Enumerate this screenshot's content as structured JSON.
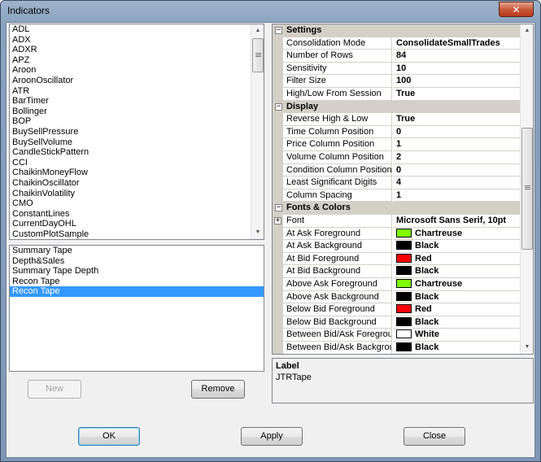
{
  "window": {
    "title": "Indicators",
    "close_glyph": "✕"
  },
  "indicators": [
    "ADL",
    "ADX",
    "ADXR",
    "APZ",
    "Aroon",
    "AroonOscillator",
    "ATR",
    "BarTimer",
    "Bollinger",
    "BOP",
    "BuySellPressure",
    "BuySellVolume",
    "CandleStickPattern",
    "CCI",
    "ChaikinMoneyFlow",
    "ChaikinOscillator",
    "ChaikinVolatility",
    "CMO",
    "ConstantLines",
    "CurrentDayOHL",
    "CustomPlotSample"
  ],
  "configured": {
    "items": [
      "Summary Tape",
      "Depth&Sales",
      "Summary Tape Depth",
      "Recon Tape",
      "Recon Tape"
    ],
    "selected_index": 4
  },
  "buttons": {
    "new": "New",
    "remove": "Remove",
    "ok": "OK",
    "apply": "Apply",
    "close": "Close"
  },
  "properties": {
    "settings": {
      "label": "Settings",
      "rows": [
        {
          "name": "Consolidation Mode",
          "value": "ConsolidateSmallTrades"
        },
        {
          "name": "Number of Rows",
          "value": "84"
        },
        {
          "name": "Sensitivity",
          "value": "10"
        },
        {
          "name": "Filter Size",
          "value": "100"
        },
        {
          "name": "High/Low From Session",
          "value": "True"
        }
      ]
    },
    "display": {
      "label": "Display",
      "rows": [
        {
          "name": "Reverse High & Low",
          "value": "True"
        },
        {
          "name": "Time Column Position",
          "value": "0"
        },
        {
          "name": "Price Column Position",
          "value": "1"
        },
        {
          "name": "Volume Column Position",
          "value": "2"
        },
        {
          "name": "Condition Column Position",
          "value": "0"
        },
        {
          "name": "Least Significant Digits",
          "value": "4"
        },
        {
          "name": "Column Spacing",
          "value": "1"
        }
      ]
    },
    "fonts": {
      "label": "Fonts & Colors",
      "font_row": {
        "name": "Font",
        "value": "Microsoft Sans Serif, 10pt"
      },
      "color_rows": [
        {
          "name": "At Ask Foreground",
          "value": "Chartreuse",
          "color": "#7fff00"
        },
        {
          "name": "At Ask Background",
          "value": "Black",
          "color": "#000000"
        },
        {
          "name": "At Bid Foreground",
          "value": "Red",
          "color": "#ff0000"
        },
        {
          "name": "At Bid Background",
          "value": "Black",
          "color": "#000000"
        },
        {
          "name": "Above Ask Foreground",
          "value": "Chartreuse",
          "color": "#7fff00"
        },
        {
          "name": "Above Ask Background",
          "value": "Black",
          "color": "#000000"
        },
        {
          "name": "Below Bid Foreground",
          "value": "Red",
          "color": "#ff0000"
        },
        {
          "name": "Below Bid Background",
          "value": "Black",
          "color": "#000000"
        },
        {
          "name": "Between Bid/Ask Foregrour",
          "value": "White",
          "color": "#ffffff"
        },
        {
          "name": "Between Bid/Ask Backgrour",
          "value": "Black",
          "color": "#000000"
        }
      ]
    }
  },
  "description": {
    "title": "Label",
    "text": "JTRTape"
  }
}
